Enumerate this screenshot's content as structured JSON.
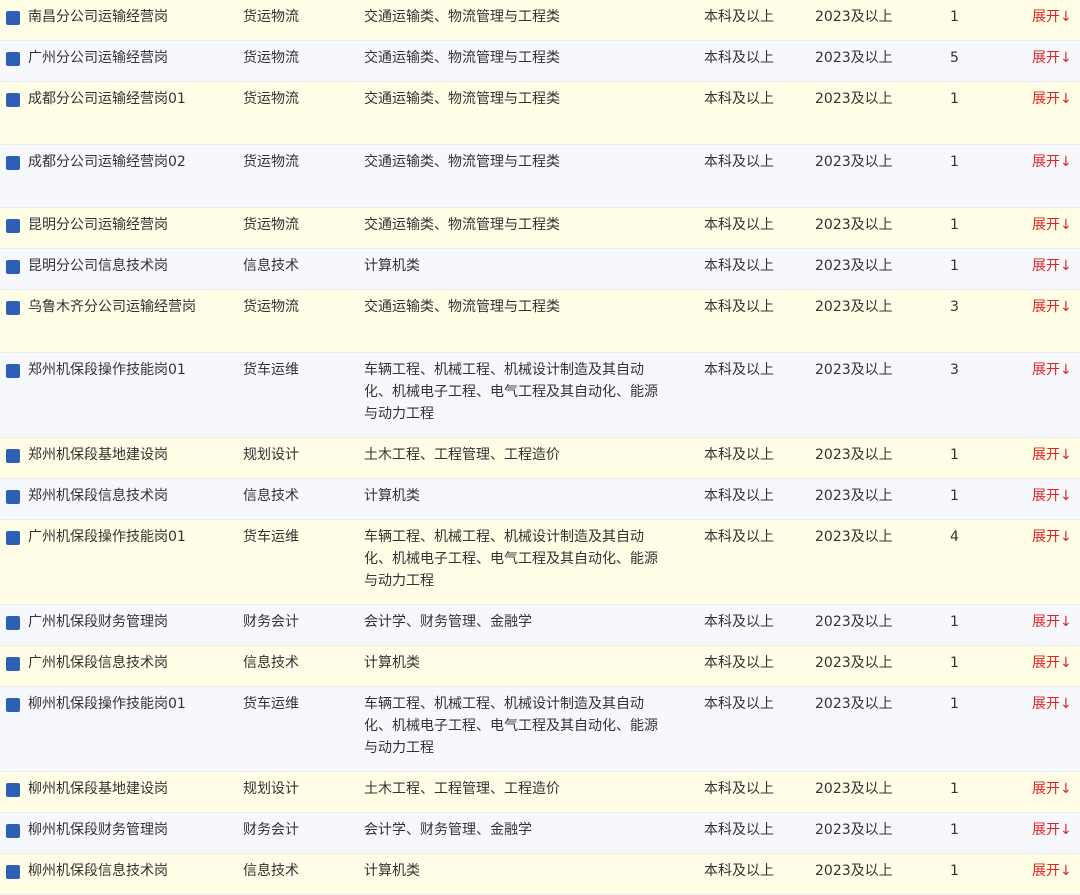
{
  "rows": [
    {
      "name": "南昌分公司运输经营岗",
      "category": "货运物流",
      "major": "交通运输类、物流管理与工程类",
      "education": "本科及以上",
      "year": "2023及以上",
      "count": "1",
      "more": "展开↓"
    },
    {
      "name": "广州分公司运输经营岗",
      "category": "货运物流",
      "major": "交通运输类、物流管理与工程类",
      "education": "本科及以上",
      "year": "2023及以上",
      "count": "5",
      "more": "展开↓"
    },
    {
      "name": "成都分公司运输经营岗01",
      "category": "货运物流",
      "major": "交通运输类、物流管理与工程类",
      "education": "本科及以上",
      "year": "2023及以上",
      "count": "1",
      "more": "展开↓"
    },
    {
      "name": "成都分公司运输经营岗02",
      "category": "货运物流",
      "major": "交通运输类、物流管理与工程类",
      "education": "本科及以上",
      "year": "2023及以上",
      "count": "1",
      "more": "展开↓"
    },
    {
      "name": "昆明分公司运输经营岗",
      "category": "货运物流",
      "major": "交通运输类、物流管理与工程类",
      "education": "本科及以上",
      "year": "2023及以上",
      "count": "1",
      "more": "展开↓"
    },
    {
      "name": "昆明分公司信息技术岗",
      "category": "信息技术",
      "major": "计算机类",
      "education": "本科及以上",
      "year": "2023及以上",
      "count": "1",
      "more": "展开↓"
    },
    {
      "name": "乌鲁木齐分公司运输经营岗",
      "category": "货运物流",
      "major": "交通运输类、物流管理与工程类",
      "education": "本科及以上",
      "year": "2023及以上",
      "count": "3",
      "more": "展开↓"
    },
    {
      "name": "郑州机保段操作技能岗01",
      "category": "货车运维",
      "major": "车辆工程、机械工程、机械设计制造及其自动化、机械电子工程、电气工程及其自动化、能源与动力工程",
      "education": "本科及以上",
      "year": "2023及以上",
      "count": "3",
      "more": "展开↓"
    },
    {
      "name": "郑州机保段基地建设岗",
      "category": "规划设计",
      "major": "土木工程、工程管理、工程造价",
      "education": "本科及以上",
      "year": "2023及以上",
      "count": "1",
      "more": "展开↓"
    },
    {
      "name": "郑州机保段信息技术岗",
      "category": "信息技术",
      "major": "计算机类",
      "education": "本科及以上",
      "year": "2023及以上",
      "count": "1",
      "more": "展开↓"
    },
    {
      "name": "广州机保段操作技能岗01",
      "category": "货车运维",
      "major": "车辆工程、机械工程、机械设计制造及其自动化、机械电子工程、电气工程及其自动化、能源与动力工程",
      "education": "本科及以上",
      "year": "2023及以上",
      "count": "4",
      "more": "展开↓"
    },
    {
      "name": "广州机保段财务管理岗",
      "category": "财务会计",
      "major": "会计学、财务管理、金融学",
      "education": "本科及以上",
      "year": "2023及以上",
      "count": "1",
      "more": "展开↓"
    },
    {
      "name": "广州机保段信息技术岗",
      "category": "信息技术",
      "major": "计算机类",
      "education": "本科及以上",
      "year": "2023及以上",
      "count": "1",
      "more": "展开↓"
    },
    {
      "name": "柳州机保段操作技能岗01",
      "category": "货车运维",
      "major": "车辆工程、机械工程、机械设计制造及其自动化、机械电子工程、电气工程及其自动化、能源与动力工程",
      "education": "本科及以上",
      "year": "2023及以上",
      "count": "1",
      "more": "展开↓"
    },
    {
      "name": "柳州机保段基地建设岗",
      "category": "规划设计",
      "major": "土木工程、工程管理、工程造价",
      "education": "本科及以上",
      "year": "2023及以上",
      "count": "1",
      "more": "展开↓"
    },
    {
      "name": "柳州机保段财务管理岗",
      "category": "财务会计",
      "major": "会计学、财务管理、金融学",
      "education": "本科及以上",
      "year": "2023及以上",
      "count": "1",
      "more": "展开↓"
    },
    {
      "name": "柳州机保段信息技术岗",
      "category": "信息技术",
      "major": "计算机类",
      "education": "本科及以上",
      "year": "2023及以上",
      "count": "1",
      "more": "展开↓"
    }
  ]
}
